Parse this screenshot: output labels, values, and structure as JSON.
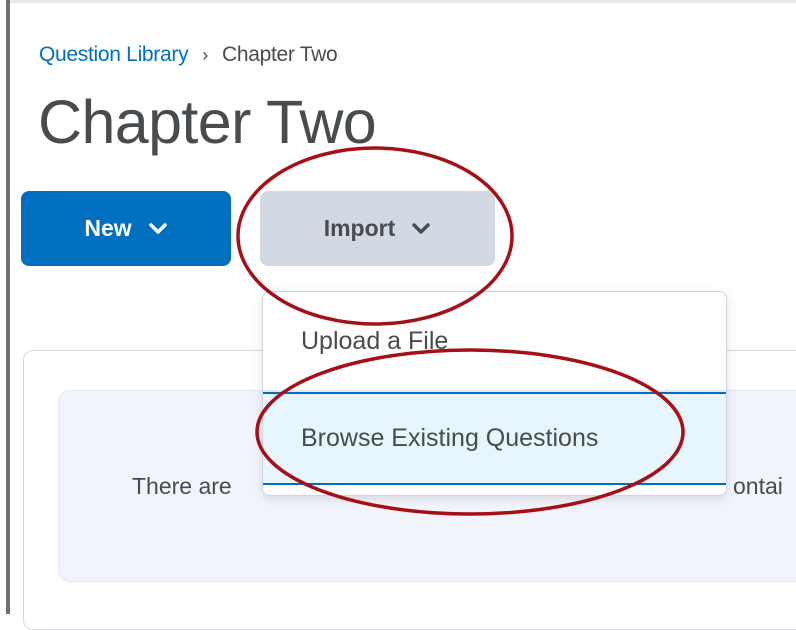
{
  "breadcrumb": {
    "items": [
      "Question Library",
      "Chapter Two"
    ],
    "separator": "›"
  },
  "page": {
    "title": "Chapter Two"
  },
  "toolbar": {
    "new_label": "New",
    "import_label": "Import"
  },
  "import_menu": {
    "items": [
      "Upload a File",
      "Browse Existing Questions"
    ],
    "highlighted_item": "Browse Existing Questions"
  },
  "empty_state": {
    "text_start": "There are",
    "text_end": "ontai"
  },
  "colors": {
    "primary": "#006fbf",
    "secondary_button": "#d3d9e3",
    "text": "#494c4e",
    "highlight_bg": "#e7f5fd",
    "annotation": "#a50f15"
  },
  "icons": [
    "chevron-down-icon"
  ]
}
